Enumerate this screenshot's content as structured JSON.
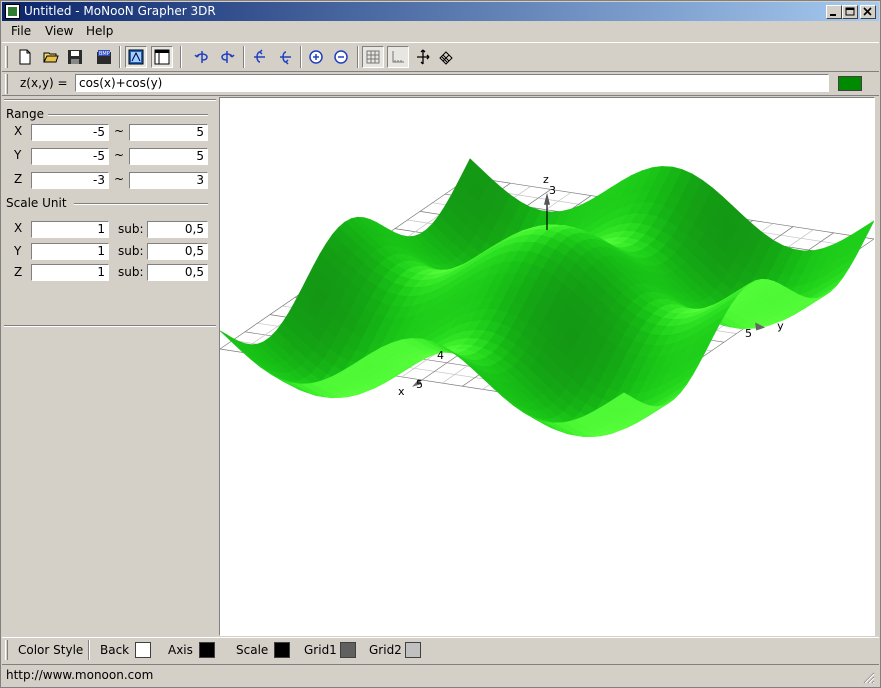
{
  "window": {
    "title": "Untitled - MoNooN Grapher 3DR"
  },
  "menu": {
    "items": [
      "File",
      "View",
      "Help"
    ]
  },
  "toolbar": {
    "buttons": [
      "new-file-icon",
      "open-folder-icon",
      "save-icon",
      "save-bmp-icon",
      "view-mode-icon",
      "panel-toggle-icon",
      "rotate-left-icon",
      "rotate-right-icon",
      "tilt-up-icon",
      "tilt-down-icon",
      "zoom-in-icon",
      "zoom-out-icon",
      "grid-icon",
      "axis-scale-icon",
      "move-icon",
      "mesh-icon"
    ]
  },
  "formula": {
    "label": "z(x,y) =",
    "value": "cos(x)+cos(y)",
    "color": "#008a00"
  },
  "range": {
    "title": "Range",
    "rows": [
      {
        "axis": "X",
        "min": "-5",
        "sep": "~",
        "max": "5"
      },
      {
        "axis": "Y",
        "min": "-5",
        "sep": "~",
        "max": "5"
      },
      {
        "axis": "Z",
        "min": "-3",
        "sep": "~",
        "max": "3"
      }
    ]
  },
  "scale": {
    "title": "Scale Unit",
    "sub_label": "sub:",
    "rows": [
      {
        "axis": "X",
        "unit": "1",
        "sub": "0,5"
      },
      {
        "axis": "Y",
        "unit": "1",
        "sub": "0,5"
      },
      {
        "axis": "Z",
        "unit": "1",
        "sub": "0,5"
      }
    ]
  },
  "plot": {
    "axis_labels": {
      "x": "x",
      "y": "y",
      "z": "z"
    },
    "tick_labels": {
      "z3": "3",
      "x4": "4",
      "x5": "5",
      "y5": "5"
    },
    "surface_color": "#2fbf2f"
  },
  "color_style": {
    "title": "Color Style",
    "items": [
      {
        "label": "Back",
        "color": "#ffffff"
      },
      {
        "label": "Axis",
        "color": "#000000"
      },
      {
        "label": "Scale",
        "color": "#000000"
      },
      {
        "label": "Grid1",
        "color": "#606060"
      },
      {
        "label": "Grid2",
        "color": "#c0c0c0"
      }
    ]
  },
  "status": {
    "text": "http://www.monoon.com"
  }
}
